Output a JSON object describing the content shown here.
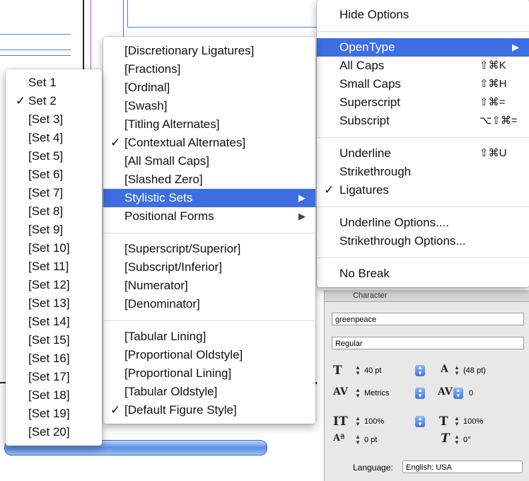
{
  "right_menu": {
    "items": [
      {
        "label": "Hide Options",
        "shortcut": "",
        "check": false,
        "highlight": false,
        "submenu": false
      },
      {
        "sep": true
      },
      {
        "label": "OpenType",
        "shortcut": "",
        "check": false,
        "highlight": true,
        "submenu": true
      },
      {
        "label": "All Caps",
        "shortcut": "⇧⌘K",
        "check": false,
        "highlight": false,
        "submenu": false
      },
      {
        "label": "Small Caps",
        "shortcut": "⇧⌘H",
        "check": false,
        "highlight": false,
        "submenu": false
      },
      {
        "label": "Superscript",
        "shortcut": "⇧⌘=",
        "check": false,
        "highlight": false,
        "submenu": false
      },
      {
        "label": "Subscript",
        "shortcut": "⌥⇧⌘=",
        "check": false,
        "highlight": false,
        "submenu": false
      },
      {
        "sep": true
      },
      {
        "label": "Underline",
        "shortcut": "⇧⌘U",
        "check": false,
        "highlight": false,
        "submenu": false
      },
      {
        "label": "Strikethrough",
        "shortcut": "",
        "check": false,
        "highlight": false,
        "submenu": false
      },
      {
        "label": "Ligatures",
        "shortcut": "",
        "check": true,
        "highlight": false,
        "submenu": false
      },
      {
        "sep": true
      },
      {
        "label": "Underline Options....",
        "shortcut": "",
        "check": false,
        "highlight": false,
        "submenu": false
      },
      {
        "label": "Strikethrough Options...",
        "shortcut": "",
        "check": false,
        "highlight": false,
        "submenu": false
      },
      {
        "sep": true
      },
      {
        "label": "No Break",
        "shortcut": "",
        "check": false,
        "highlight": false,
        "submenu": false
      }
    ]
  },
  "opentype_menu": {
    "items": [
      {
        "label": "[Discretionary Ligatures]",
        "check": false,
        "highlight": false,
        "submenu": false
      },
      {
        "label": "[Fractions]",
        "check": false,
        "highlight": false,
        "submenu": false
      },
      {
        "label": "[Ordinal]",
        "check": false,
        "highlight": false,
        "submenu": false
      },
      {
        "label": "[Swash]",
        "check": false,
        "highlight": false,
        "submenu": false
      },
      {
        "label": "[Titling Alternates]",
        "check": false,
        "highlight": false,
        "submenu": false
      },
      {
        "label": "[Contextual Alternates]",
        "check": true,
        "highlight": false,
        "submenu": false
      },
      {
        "label": "[All Small Caps]",
        "check": false,
        "highlight": false,
        "submenu": false
      },
      {
        "label": "[Slashed Zero]",
        "check": false,
        "highlight": false,
        "submenu": false
      },
      {
        "label": "Stylistic Sets",
        "check": false,
        "highlight": true,
        "submenu": true
      },
      {
        "label": "Positional Forms",
        "check": false,
        "highlight": false,
        "submenu": true
      },
      {
        "sep": true
      },
      {
        "label": "[Superscript/Superior]",
        "check": false,
        "highlight": false,
        "submenu": false
      },
      {
        "label": "[Subscript/Inferior]",
        "check": false,
        "highlight": false,
        "submenu": false
      },
      {
        "label": "[Numerator]",
        "check": false,
        "highlight": false,
        "submenu": false
      },
      {
        "label": "[Denominator]",
        "check": false,
        "highlight": false,
        "submenu": false
      },
      {
        "sep": true
      },
      {
        "label": "[Tabular Lining]",
        "check": false,
        "highlight": false,
        "submenu": false
      },
      {
        "label": "[Proportional Oldstyle]",
        "check": false,
        "highlight": false,
        "submenu": false
      },
      {
        "label": "[Proportional Lining]",
        "check": false,
        "highlight": false,
        "submenu": false
      },
      {
        "label": "[Tabular Oldstyle]",
        "check": false,
        "highlight": false,
        "submenu": false
      },
      {
        "label": "[Default Figure Style]",
        "check": true,
        "highlight": false,
        "submenu": false
      }
    ]
  },
  "sets_menu": {
    "items": [
      {
        "label": "Set 1",
        "check": false
      },
      {
        "label": "Set 2",
        "check": true
      },
      {
        "label": "[Set 3]",
        "check": false
      },
      {
        "label": "[Set 4]",
        "check": false
      },
      {
        "label": "[Set 5]",
        "check": false
      },
      {
        "label": "[Set 6]",
        "check": false
      },
      {
        "label": "[Set 7]",
        "check": false
      },
      {
        "label": "[Set 8]",
        "check": false
      },
      {
        "label": "[Set 9]",
        "check": false
      },
      {
        "label": "[Set 10]",
        "check": false
      },
      {
        "label": "[Set 11]",
        "check": false
      },
      {
        "label": "[Set 12]",
        "check": false
      },
      {
        "label": "[Set 13]",
        "check": false
      },
      {
        "label": "[Set 14]",
        "check": false
      },
      {
        "label": "[Set 15]",
        "check": false
      },
      {
        "label": "[Set 16]",
        "check": false
      },
      {
        "label": "[Set 17]",
        "check": false
      },
      {
        "label": "[Set 18]",
        "check": false
      },
      {
        "label": "[Set 19]",
        "check": false
      },
      {
        "label": "[Set 20]",
        "check": false
      }
    ]
  },
  "check_glyph": "✓",
  "arrow_glyph": "▶",
  "character_panel": {
    "tab_label": "Character",
    "font_family": "greenpeace",
    "font_style": "Regular",
    "font_size": "40 pt",
    "leading": "(48 pt)",
    "kerning": "Metrics",
    "tracking": "0",
    "vertical_scale": "100%",
    "horizontal_scale": "100%",
    "baseline_shift": "0 pt",
    "skew": "0°",
    "language_label": "Language:",
    "language_value": "English: USA"
  },
  "icons": [
    "font-size-icon",
    "leading-icon",
    "kerning-icon",
    "tracking-icon",
    "vertical-scale-icon",
    "horizontal-scale-icon",
    "baseline-shift-icon",
    "skew-icon"
  ],
  "colors": {
    "highlight": "#3d6fe3",
    "guide_magenta": "#c040e0",
    "guide_blue": "#4a7de0"
  }
}
